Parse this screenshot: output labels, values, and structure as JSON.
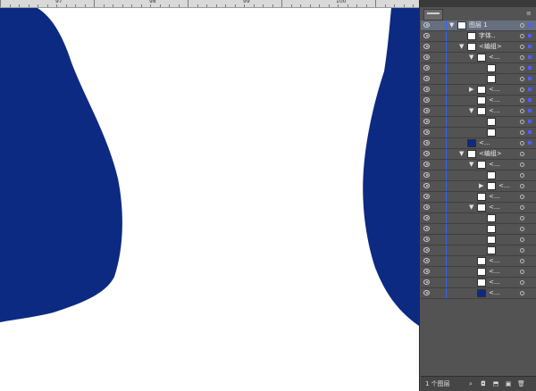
{
  "ruler": {
    "marks": [
      "97",
      "98",
      "99",
      "100"
    ]
  },
  "artwork": {
    "shape_color": "#0d2a82"
  },
  "layers_panel": {
    "layer_name": "图层 1",
    "rows": [
      {
        "kind": "layer",
        "label": "图层 1",
        "expanded": true,
        "thumb": "light"
      },
      {
        "kind": "item",
        "label": "字体..",
        "thumb": "light",
        "indent": 1
      },
      {
        "kind": "group",
        "label": "<编组>",
        "expanded": true,
        "thumb": "light",
        "indent": 1
      },
      {
        "kind": "group",
        "label": "<...",
        "expanded": true,
        "thumb": "light",
        "indent": 2
      },
      {
        "kind": "item",
        "label": "",
        "thumb": "light",
        "indent": 3
      },
      {
        "kind": "item",
        "label": "",
        "thumb": "light",
        "indent": 3
      },
      {
        "kind": "group",
        "label": "<...",
        "expanded": false,
        "thumb": "light",
        "indent": 2
      },
      {
        "kind": "item",
        "label": "<...",
        "thumb": "light",
        "indent": 2
      },
      {
        "kind": "group",
        "label": "<...",
        "expanded": true,
        "thumb": "light",
        "indent": 2
      },
      {
        "kind": "item",
        "label": "",
        "thumb": "light",
        "indent": 3
      },
      {
        "kind": "item",
        "label": "",
        "thumb": "light",
        "indent": 3
      },
      {
        "kind": "item",
        "label": "<...",
        "thumb": "dark",
        "indent": 1
      },
      {
        "kind": "group",
        "label": "<编组>",
        "expanded": true,
        "thumb": "light",
        "indent": 1
      },
      {
        "kind": "group",
        "label": "<...",
        "expanded": true,
        "thumb": "light",
        "indent": 2
      },
      {
        "kind": "item",
        "label": "",
        "thumb": "light",
        "indent": 3
      },
      {
        "kind": "group",
        "label": "<...",
        "expanded": false,
        "thumb": "light",
        "indent": 3
      },
      {
        "kind": "item",
        "label": "<...",
        "thumb": "light",
        "indent": 2
      },
      {
        "kind": "group",
        "label": "<...",
        "expanded": true,
        "thumb": "light",
        "indent": 2
      },
      {
        "kind": "item",
        "label": "",
        "thumb": "light",
        "indent": 3
      },
      {
        "kind": "item",
        "label": "",
        "thumb": "light",
        "indent": 3
      },
      {
        "kind": "item",
        "label": "",
        "thumb": "light",
        "indent": 3
      },
      {
        "kind": "item",
        "label": "",
        "thumb": "light",
        "indent": 3
      },
      {
        "kind": "item",
        "label": "<...",
        "thumb": "light",
        "indent": 2
      },
      {
        "kind": "item",
        "label": "<...",
        "thumb": "light",
        "indent": 2
      },
      {
        "kind": "item",
        "label": "<...",
        "thumb": "light",
        "indent": 2
      },
      {
        "kind": "item",
        "label": "<...",
        "thumb": "dark",
        "indent": 2
      }
    ],
    "footer": {
      "count_label": "1 个图层",
      "buttons": [
        "locate-object",
        "make-clip-mask",
        "create-sublayer",
        "create-layer",
        "delete"
      ]
    }
  }
}
